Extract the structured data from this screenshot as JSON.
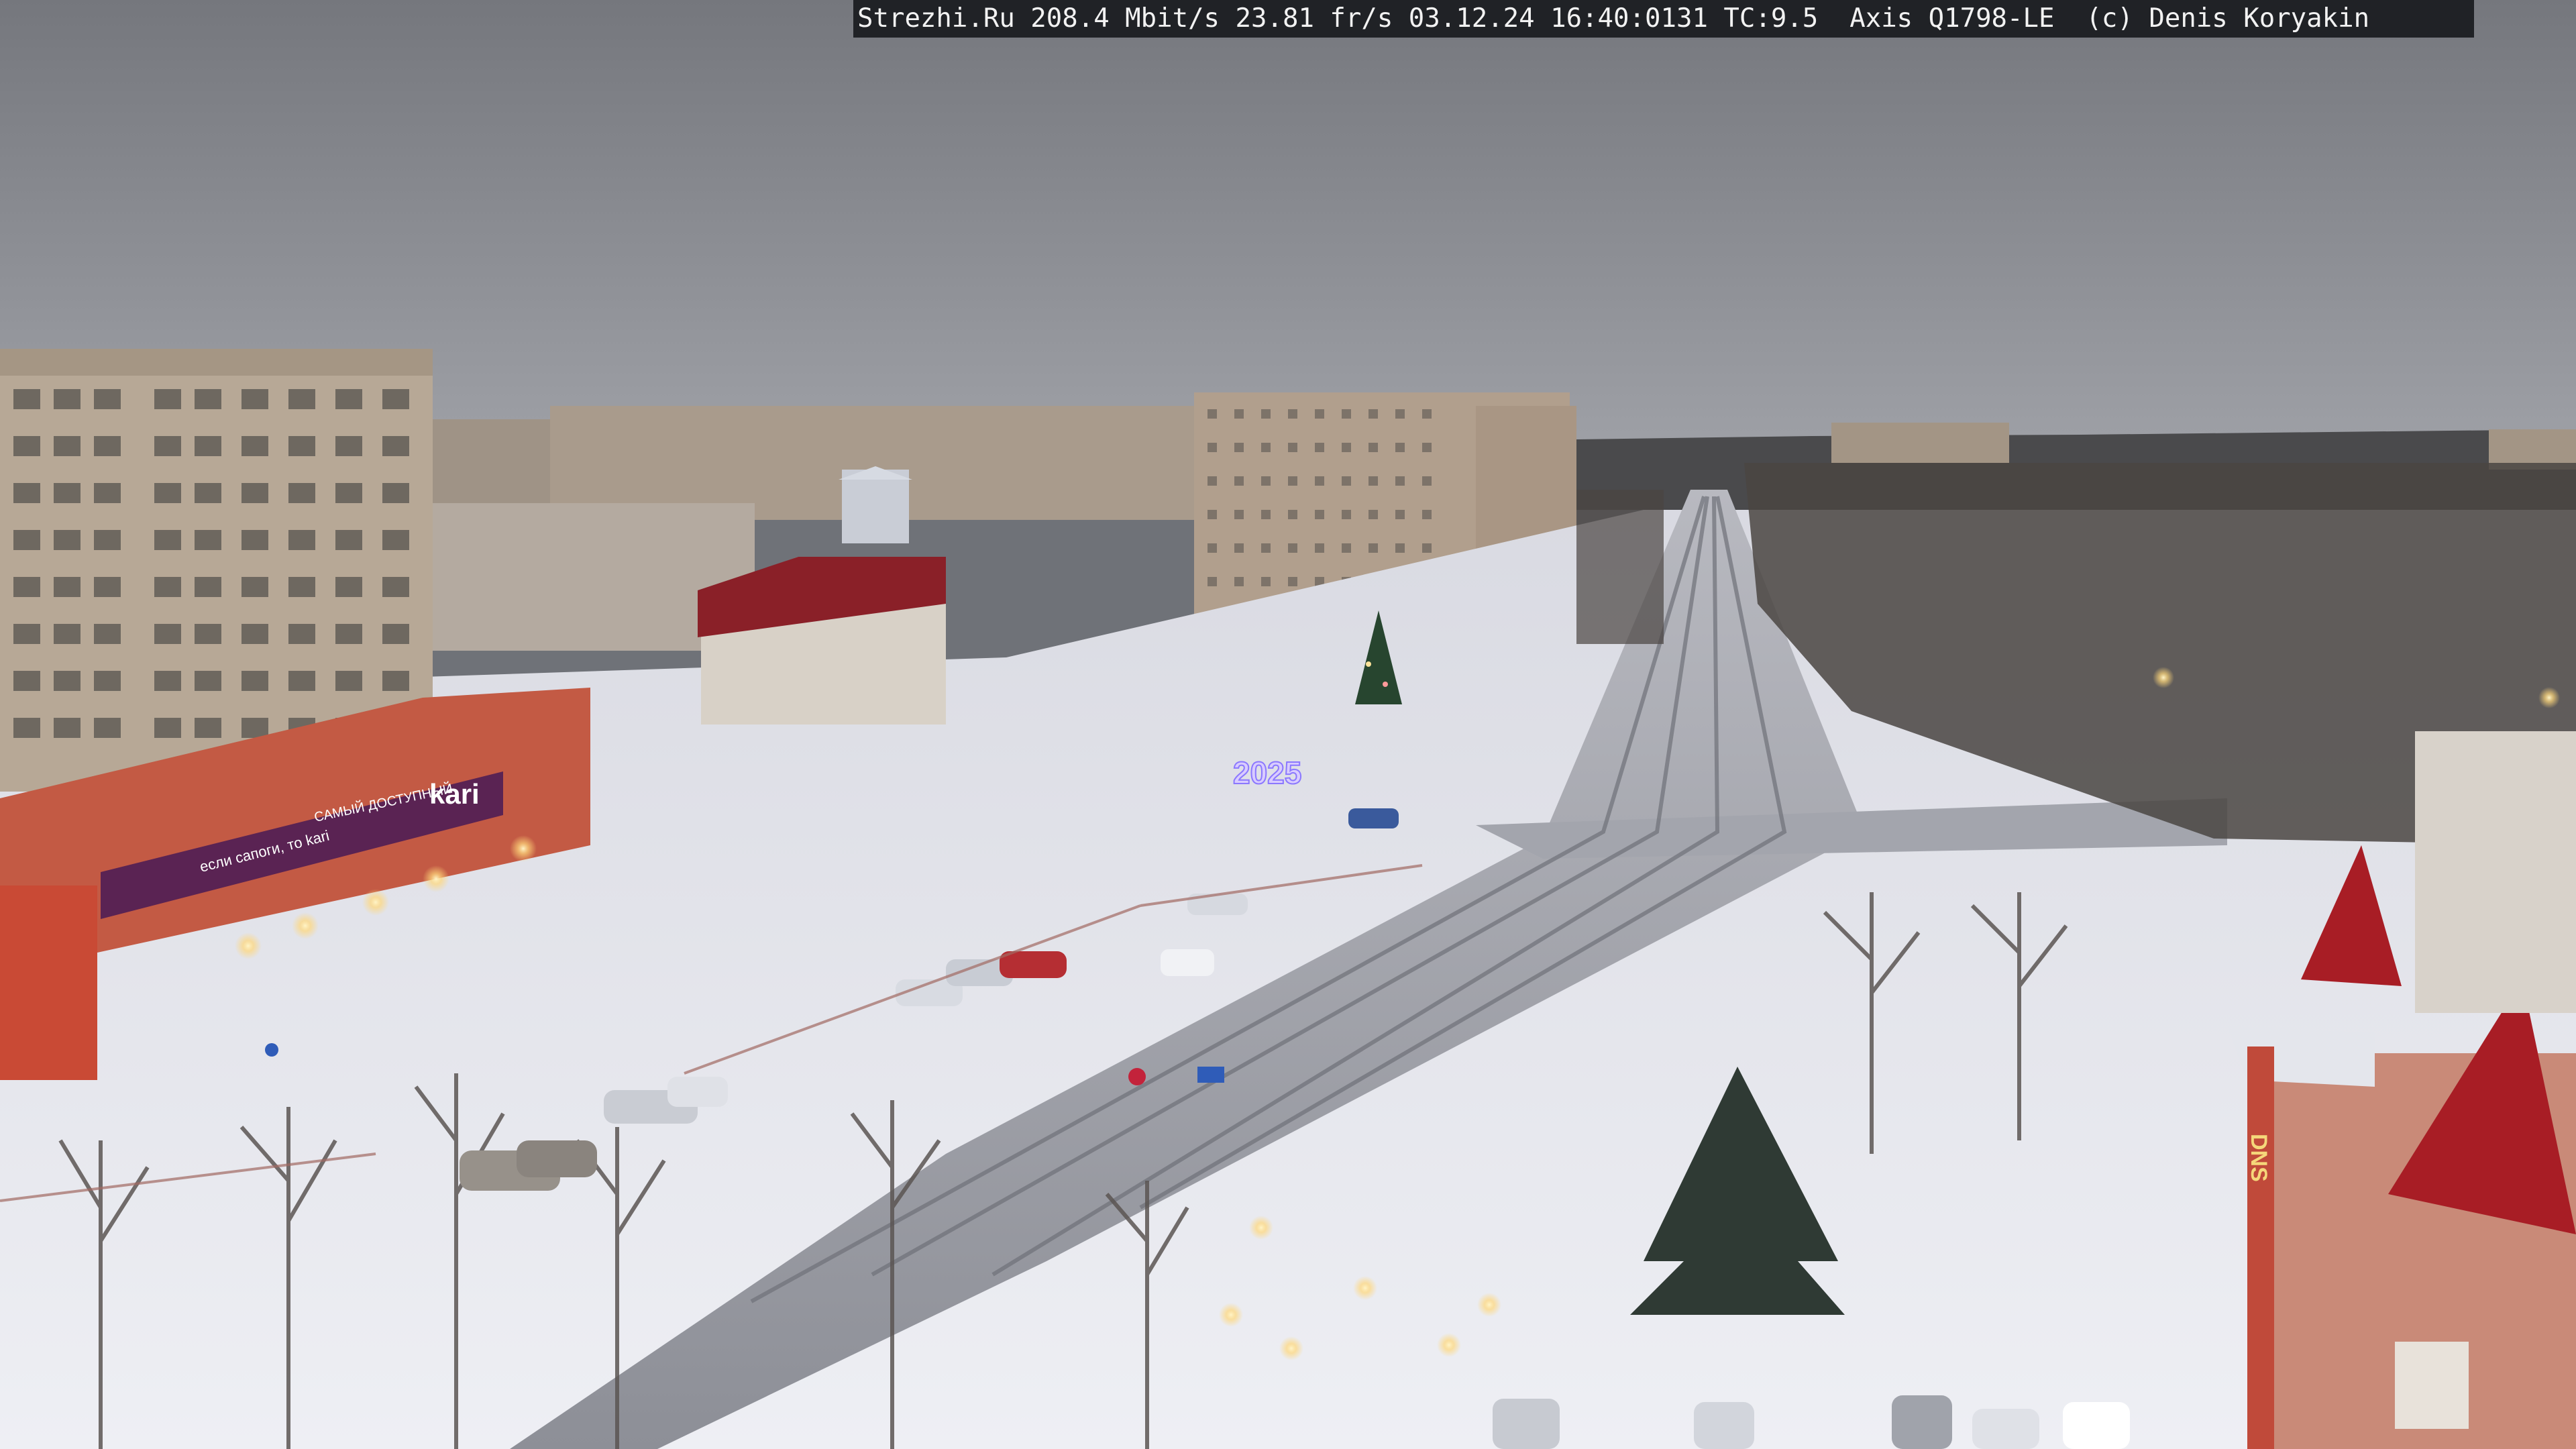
{
  "camera_overlay": {
    "text": "Strezhi.Ru 208.4 Mbit/s 23.81 fr/s 03.12.24 16:40:0131 TC:9.5  Axis Q1798-LE  (c) Denis Koryakin"
  },
  "signs": {
    "kari_store": "kari",
    "kari_slogan": "САМЫЙ ДОСТУПНЫЙ",
    "kari_banner_left": "если сапоги, то kari",
    "new_year_display": "2025",
    "dns_store": "DNS"
  },
  "colors": {
    "sky": "#8f9196",
    "snow": "#e7e8ee",
    "road": "#9c9ea6",
    "brick_red": "#b5473a",
    "roof_red": "#9c1f25",
    "kari_purple": "#5a2353",
    "panel_buildings": "#b3a493",
    "trees_dark": "#3c3936"
  }
}
